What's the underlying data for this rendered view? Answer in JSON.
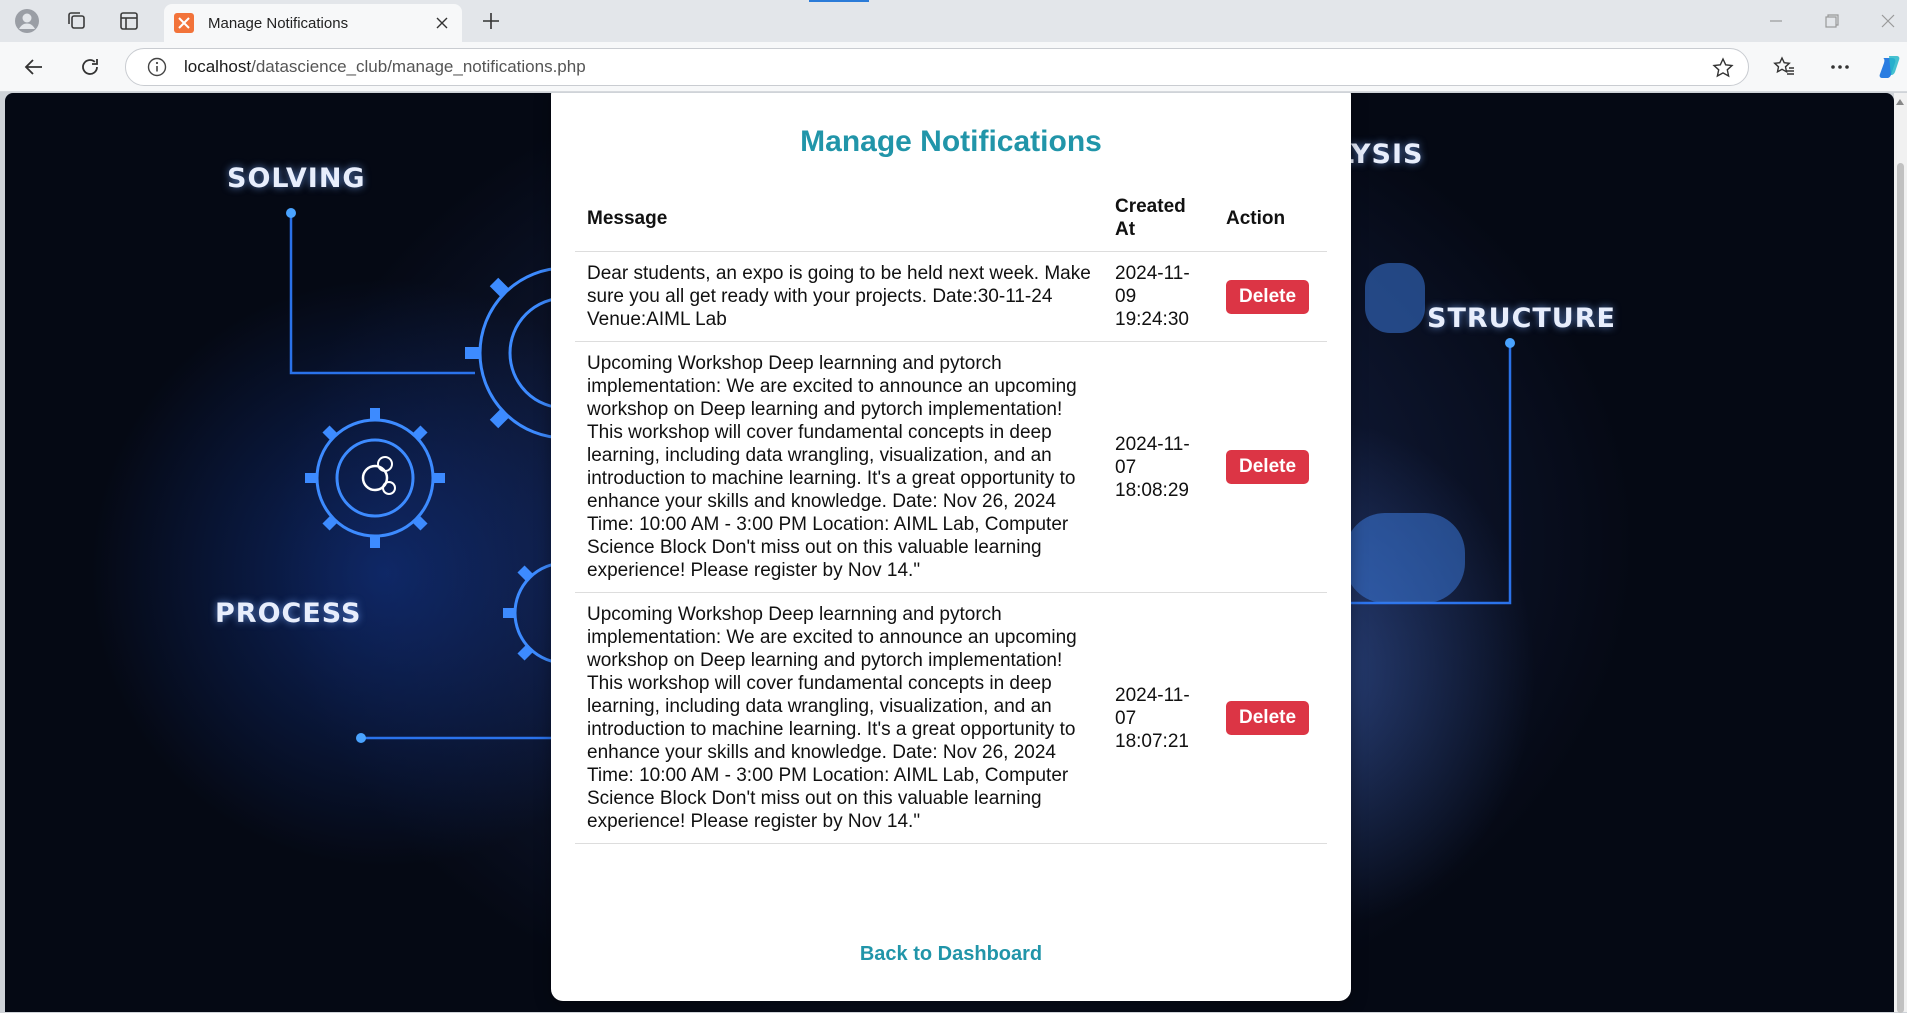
{
  "browser": {
    "tab_title": "Manage Notifications",
    "url_host": "localhost",
    "url_path": "/datascience_club/manage_notifications.php"
  },
  "background": {
    "labels": [
      "SOLVING",
      "LYSIS",
      "STRUCTURE",
      "PROCESS"
    ]
  },
  "page": {
    "title": "Manage Notifications",
    "table": {
      "headers": {
        "message": "Message",
        "created_at": "Created At",
        "action": "Action"
      },
      "rows": [
        {
          "message": "Dear students, an expo is going to be held next week. Make sure you all get ready with your projects. Date:30-11-24 Venue:AIML Lab",
          "created_at": "2024-11-09 19:24:30",
          "action_label": "Delete"
        },
        {
          "message": "Upcoming Workshop Deep learnning and pytorch implementation: We are excited to announce an upcoming workshop on Deep learning and pytorch implementation! This workshop will cover fundamental concepts in deep learning, including data wrangling, visualization, and an introduction to machine learning. It's a great opportunity to enhance your skills and knowledge. Date: Nov 26, 2024 Time: 10:00 AM - 3:00 PM Location: AIML Lab, Computer Science Block Don't miss out on this valuable learning experience! Please register by Nov 14.\"",
          "created_at": "2024-11-07 18:08:29",
          "action_label": "Delete"
        },
        {
          "message": "Upcoming Workshop Deep learnning and pytorch implementation: We are excited to announce an upcoming workshop on Deep learning and pytorch implementation! This workshop will cover fundamental concepts in deep learning, including data wrangling, visualization, and an introduction to machine learning. It's a great opportunity to enhance your skills and knowledge. Date: Nov 26, 2024 Time: 10:00 AM - 3:00 PM Location: AIML Lab, Computer Science Block Don't miss out on this valuable learning experience! Please register by Nov 14.\"",
          "created_at": "2024-11-07 18:07:21",
          "action_label": "Delete"
        }
      ]
    },
    "back_link": "Back to Dashboard"
  },
  "colors": {
    "accent": "#2195a9",
    "delete": "#dc3545"
  }
}
